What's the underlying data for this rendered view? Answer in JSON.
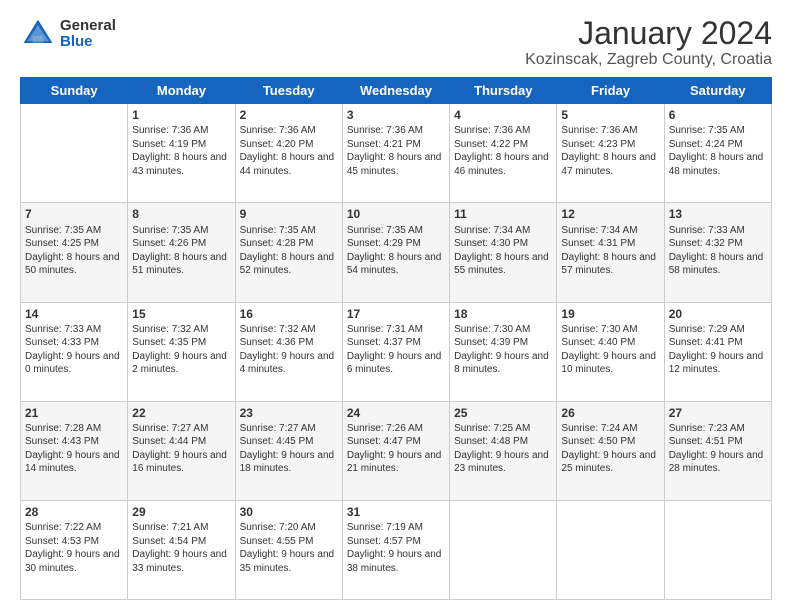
{
  "logo": {
    "general": "General",
    "blue": "Blue"
  },
  "title": "January 2024",
  "subtitle": "Kozinscak, Zagreb County, Croatia",
  "days_of_week": [
    "Sunday",
    "Monday",
    "Tuesday",
    "Wednesday",
    "Thursday",
    "Friday",
    "Saturday"
  ],
  "weeks": [
    [
      {
        "day": "",
        "sunrise": "",
        "sunset": "",
        "daylight": ""
      },
      {
        "day": "1",
        "sunrise": "Sunrise: 7:36 AM",
        "sunset": "Sunset: 4:19 PM",
        "daylight": "Daylight: 8 hours and 43 minutes."
      },
      {
        "day": "2",
        "sunrise": "Sunrise: 7:36 AM",
        "sunset": "Sunset: 4:20 PM",
        "daylight": "Daylight: 8 hours and 44 minutes."
      },
      {
        "day": "3",
        "sunrise": "Sunrise: 7:36 AM",
        "sunset": "Sunset: 4:21 PM",
        "daylight": "Daylight: 8 hours and 45 minutes."
      },
      {
        "day": "4",
        "sunrise": "Sunrise: 7:36 AM",
        "sunset": "Sunset: 4:22 PM",
        "daylight": "Daylight: 8 hours and 46 minutes."
      },
      {
        "day": "5",
        "sunrise": "Sunrise: 7:36 AM",
        "sunset": "Sunset: 4:23 PM",
        "daylight": "Daylight: 8 hours and 47 minutes."
      },
      {
        "day": "6",
        "sunrise": "Sunrise: 7:35 AM",
        "sunset": "Sunset: 4:24 PM",
        "daylight": "Daylight: 8 hours and 48 minutes."
      }
    ],
    [
      {
        "day": "7",
        "sunrise": "Sunrise: 7:35 AM",
        "sunset": "Sunset: 4:25 PM",
        "daylight": "Daylight: 8 hours and 50 minutes."
      },
      {
        "day": "8",
        "sunrise": "Sunrise: 7:35 AM",
        "sunset": "Sunset: 4:26 PM",
        "daylight": "Daylight: 8 hours and 51 minutes."
      },
      {
        "day": "9",
        "sunrise": "Sunrise: 7:35 AM",
        "sunset": "Sunset: 4:28 PM",
        "daylight": "Daylight: 8 hours and 52 minutes."
      },
      {
        "day": "10",
        "sunrise": "Sunrise: 7:35 AM",
        "sunset": "Sunset: 4:29 PM",
        "daylight": "Daylight: 8 hours and 54 minutes."
      },
      {
        "day": "11",
        "sunrise": "Sunrise: 7:34 AM",
        "sunset": "Sunset: 4:30 PM",
        "daylight": "Daylight: 8 hours and 55 minutes."
      },
      {
        "day": "12",
        "sunrise": "Sunrise: 7:34 AM",
        "sunset": "Sunset: 4:31 PM",
        "daylight": "Daylight: 8 hours and 57 minutes."
      },
      {
        "day": "13",
        "sunrise": "Sunrise: 7:33 AM",
        "sunset": "Sunset: 4:32 PM",
        "daylight": "Daylight: 8 hours and 58 minutes."
      }
    ],
    [
      {
        "day": "14",
        "sunrise": "Sunrise: 7:33 AM",
        "sunset": "Sunset: 4:33 PM",
        "daylight": "Daylight: 9 hours and 0 minutes."
      },
      {
        "day": "15",
        "sunrise": "Sunrise: 7:32 AM",
        "sunset": "Sunset: 4:35 PM",
        "daylight": "Daylight: 9 hours and 2 minutes."
      },
      {
        "day": "16",
        "sunrise": "Sunrise: 7:32 AM",
        "sunset": "Sunset: 4:36 PM",
        "daylight": "Daylight: 9 hours and 4 minutes."
      },
      {
        "day": "17",
        "sunrise": "Sunrise: 7:31 AM",
        "sunset": "Sunset: 4:37 PM",
        "daylight": "Daylight: 9 hours and 6 minutes."
      },
      {
        "day": "18",
        "sunrise": "Sunrise: 7:30 AM",
        "sunset": "Sunset: 4:39 PM",
        "daylight": "Daylight: 9 hours and 8 minutes."
      },
      {
        "day": "19",
        "sunrise": "Sunrise: 7:30 AM",
        "sunset": "Sunset: 4:40 PM",
        "daylight": "Daylight: 9 hours and 10 minutes."
      },
      {
        "day": "20",
        "sunrise": "Sunrise: 7:29 AM",
        "sunset": "Sunset: 4:41 PM",
        "daylight": "Daylight: 9 hours and 12 minutes."
      }
    ],
    [
      {
        "day": "21",
        "sunrise": "Sunrise: 7:28 AM",
        "sunset": "Sunset: 4:43 PM",
        "daylight": "Daylight: 9 hours and 14 minutes."
      },
      {
        "day": "22",
        "sunrise": "Sunrise: 7:27 AM",
        "sunset": "Sunset: 4:44 PM",
        "daylight": "Daylight: 9 hours and 16 minutes."
      },
      {
        "day": "23",
        "sunrise": "Sunrise: 7:27 AM",
        "sunset": "Sunset: 4:45 PM",
        "daylight": "Daylight: 9 hours and 18 minutes."
      },
      {
        "day": "24",
        "sunrise": "Sunrise: 7:26 AM",
        "sunset": "Sunset: 4:47 PM",
        "daylight": "Daylight: 9 hours and 21 minutes."
      },
      {
        "day": "25",
        "sunrise": "Sunrise: 7:25 AM",
        "sunset": "Sunset: 4:48 PM",
        "daylight": "Daylight: 9 hours and 23 minutes."
      },
      {
        "day": "26",
        "sunrise": "Sunrise: 7:24 AM",
        "sunset": "Sunset: 4:50 PM",
        "daylight": "Daylight: 9 hours and 25 minutes."
      },
      {
        "day": "27",
        "sunrise": "Sunrise: 7:23 AM",
        "sunset": "Sunset: 4:51 PM",
        "daylight": "Daylight: 9 hours and 28 minutes."
      }
    ],
    [
      {
        "day": "28",
        "sunrise": "Sunrise: 7:22 AM",
        "sunset": "Sunset: 4:53 PM",
        "daylight": "Daylight: 9 hours and 30 minutes."
      },
      {
        "day": "29",
        "sunrise": "Sunrise: 7:21 AM",
        "sunset": "Sunset: 4:54 PM",
        "daylight": "Daylight: 9 hours and 33 minutes."
      },
      {
        "day": "30",
        "sunrise": "Sunrise: 7:20 AM",
        "sunset": "Sunset: 4:55 PM",
        "daylight": "Daylight: 9 hours and 35 minutes."
      },
      {
        "day": "31",
        "sunrise": "Sunrise: 7:19 AM",
        "sunset": "Sunset: 4:57 PM",
        "daylight": "Daylight: 9 hours and 38 minutes."
      },
      {
        "day": "",
        "sunrise": "",
        "sunset": "",
        "daylight": ""
      },
      {
        "day": "",
        "sunrise": "",
        "sunset": "",
        "daylight": ""
      },
      {
        "day": "",
        "sunrise": "",
        "sunset": "",
        "daylight": ""
      }
    ]
  ]
}
